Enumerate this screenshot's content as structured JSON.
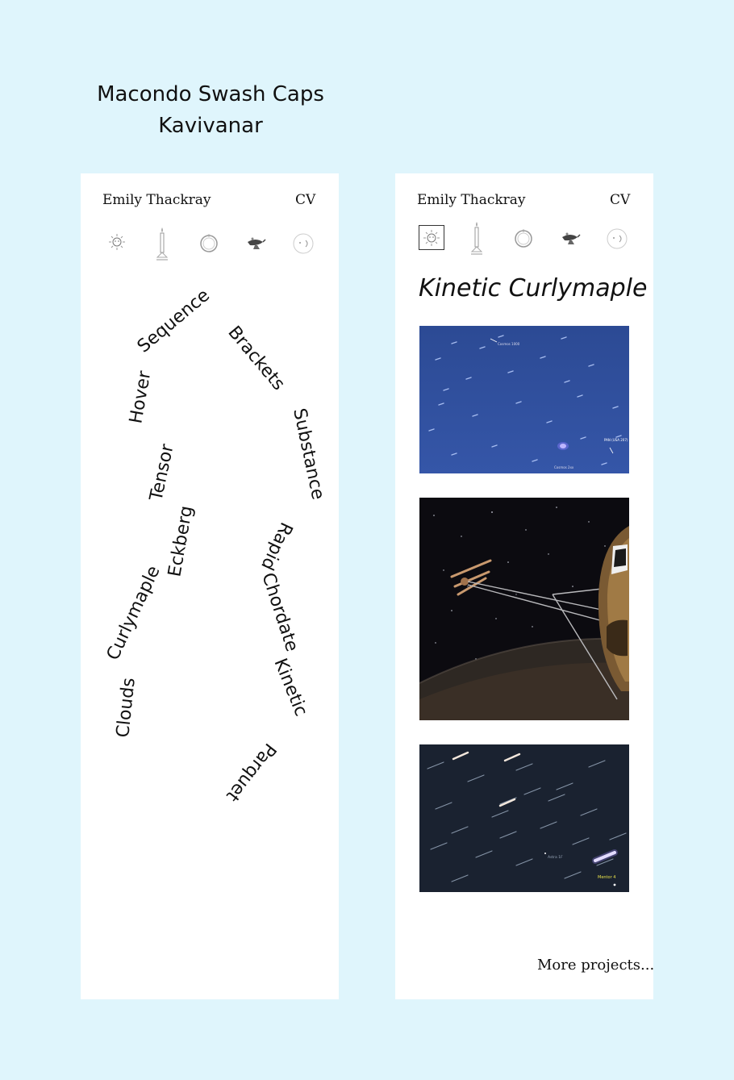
{
  "page": {
    "title_line1": "Macondo Swash Caps",
    "title_line2": "Kavivanar"
  },
  "left_card": {
    "author": "Emily Thackray",
    "cv_label": "CV",
    "icons": [
      "sun-icon",
      "candle-icon",
      "ring-icon",
      "oil-lamp-icon",
      "moon-face-icon"
    ],
    "words": [
      "Clouds",
      "Curlymaple",
      "Eckberg",
      "Tensor",
      "Hover",
      "Sequence",
      "Brackets",
      "Substance",
      "Rapid",
      "Chordate",
      "Kinetic",
      "Parquet"
    ]
  },
  "right_card": {
    "author": "Emily Thackray",
    "cv_label": "CV",
    "icons": [
      "sun-icon",
      "candle-icon",
      "ring-icon",
      "oil-lamp-icon",
      "moon-face-icon"
    ],
    "selected_icon": "sun-icon",
    "project_title": "Kinetic Curlymaple",
    "photo1_labels": [
      "Cosmos 1000",
      "PAN (USA 207)",
      "Cosmos 2xx"
    ],
    "photo3_labels": [
      "Astra 1F",
      "Mentor 4"
    ],
    "more_link": "More projects..."
  },
  "colors": {
    "background": "#dff5fc",
    "card": "#ffffff",
    "text": "#111111",
    "photo1_sky": "#2f4e9a",
    "photo3_sky": "#1a2230",
    "label_yellow": "#e8e24a"
  }
}
